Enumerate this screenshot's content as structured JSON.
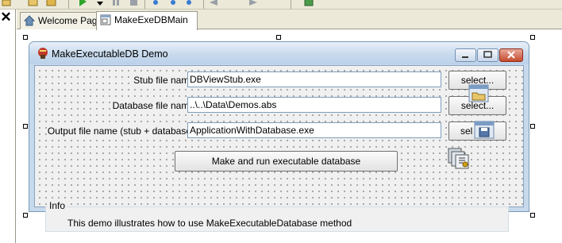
{
  "ide": {
    "toolbar_icons": [
      "open-icon",
      "save-icon",
      "run-icon",
      "pause-icon",
      "stop-icon",
      "step-icon",
      "step-into-icon",
      "step-over-icon",
      "back-icon",
      "forward-icon",
      "components-icon"
    ]
  },
  "tabs": [
    {
      "label": "Welcome Page",
      "icon": "home-icon",
      "active": false
    },
    {
      "label": "MakeExeDBMain",
      "icon": "form-icon",
      "active": true
    }
  ],
  "form": {
    "title": "MakeExecutableDB Demo",
    "fields": {
      "stub_label": "Stub file name",
      "stub_value": "DBViewStub.exe",
      "database_label": "Database file name",
      "database_value": "..\\..\\Data\\Demos.abs",
      "output_label": "Output file name (stub + database)",
      "output_value": "ApplicationWithDatabase.exe"
    },
    "buttons": {
      "select1": "select...",
      "select2": "select...",
      "select3": "sel",
      "make": "Make and run executable database"
    },
    "info": {
      "caption": "Info",
      "text": "This demo illustrates how to use MakeExecutableDatabase method"
    }
  },
  "colors": {
    "title_bar": "#c5d8ec",
    "form_border": "#7b9ab9",
    "close_button": "#c54a2d"
  }
}
